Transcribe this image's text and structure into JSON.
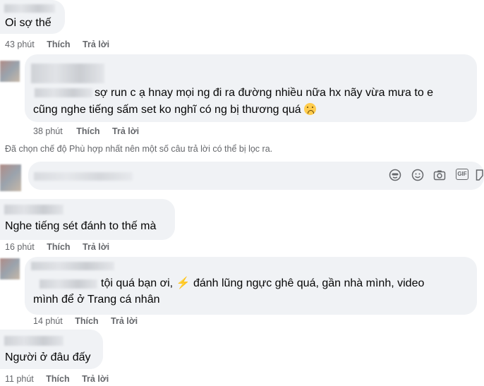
{
  "comments": [
    {
      "text": "Oi sợ thế",
      "time": "43 phút"
    },
    {
      "line1": "sợ run c ạ hnay mọi ng đi ra đường nhiều nữa hx nãy vừa mưa to e",
      "line2": "cũng nghe tiếng sấm set ko nghĩ có ng bị thương quá",
      "time": "38 phút"
    },
    {
      "text": "Nghe tiếng sét đánh to thế mà",
      "time": "16 phút"
    },
    {
      "line1a": "tội quá bạn ơi,",
      "bolt": "⚡",
      "line1b": "đánh lũng ngực ghê quá, gần nhà mình, video",
      "line2": "mình để ở Trang cá nhân",
      "time": "14 phút"
    },
    {
      "text": "Người ở đâu đấy",
      "time": "11 phút"
    }
  ],
  "actions": {
    "like": "Thích",
    "reply": "Trả lời"
  },
  "notice": "Đã chọn chế độ Phù hợp nhất nên một số câu trả lời có thể bị lọc ra.",
  "composer": {
    "icons": [
      "avatar-sticker-icon",
      "emoji-icon",
      "camera-icon",
      "gif-icon",
      "sticker-icon"
    ],
    "gif_label": "GIF"
  }
}
